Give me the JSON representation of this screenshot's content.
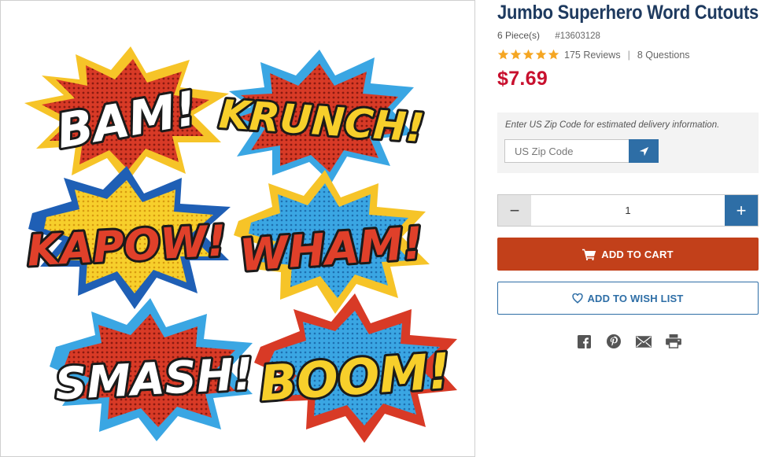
{
  "product": {
    "title": "Jumbo Superhero Word Cutouts",
    "pieces": "6 Piece(s)",
    "sku": "#13603128",
    "rating_stars": 5,
    "reviews": "175 Reviews",
    "separator": "|",
    "questions": "8 Questions",
    "price": "$7.69"
  },
  "image": {
    "cutouts": [
      "BAM!",
      "KRUNCH!",
      "KAPOW!",
      "WHAM!",
      "SMASH!",
      "BOOM!"
    ]
  },
  "zip": {
    "hint": "Enter US Zip Code for estimated delivery information.",
    "placeholder": "US Zip Code",
    "button_icon": "location-arrow-icon"
  },
  "quantity": {
    "minus": "−",
    "value": "1",
    "plus": "+"
  },
  "buttons": {
    "add_to_cart": "ADD TO CART",
    "add_to_wish_list": "ADD TO WISH LIST"
  },
  "share": [
    "facebook-icon",
    "pinterest-icon",
    "email-icon",
    "print-icon"
  ],
  "colors": {
    "title": "#1e3a5f",
    "price": "#c8102e",
    "star": "#f5a623",
    "accent_blue": "#2e6ea6",
    "cart_orange": "#c2401a"
  }
}
